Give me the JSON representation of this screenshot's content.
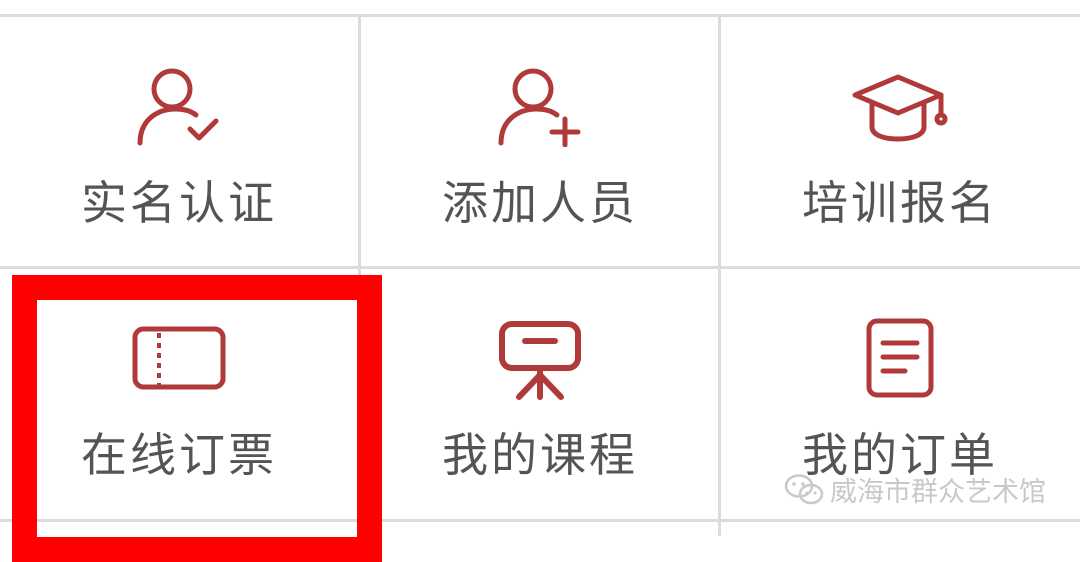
{
  "menu": {
    "items": [
      {
        "label": "实名认证",
        "icon": "user-check-icon"
      },
      {
        "label": "添加人员",
        "icon": "user-add-icon"
      },
      {
        "label": "培训报名",
        "icon": "graduation-cap-icon"
      },
      {
        "label": "在线订票",
        "icon": "ticket-icon"
      },
      {
        "label": "我的课程",
        "icon": "presentation-icon"
      },
      {
        "label": "我的订单",
        "icon": "document-icon"
      }
    ],
    "highlighted_index": 3
  },
  "watermark": {
    "text": "威海市群众艺术馆",
    "icon": "wechat-icon"
  },
  "colors": {
    "icon": "#b03a3a",
    "label": "#545454",
    "highlight": "#ff0000",
    "divider": "#dcdcdc"
  }
}
